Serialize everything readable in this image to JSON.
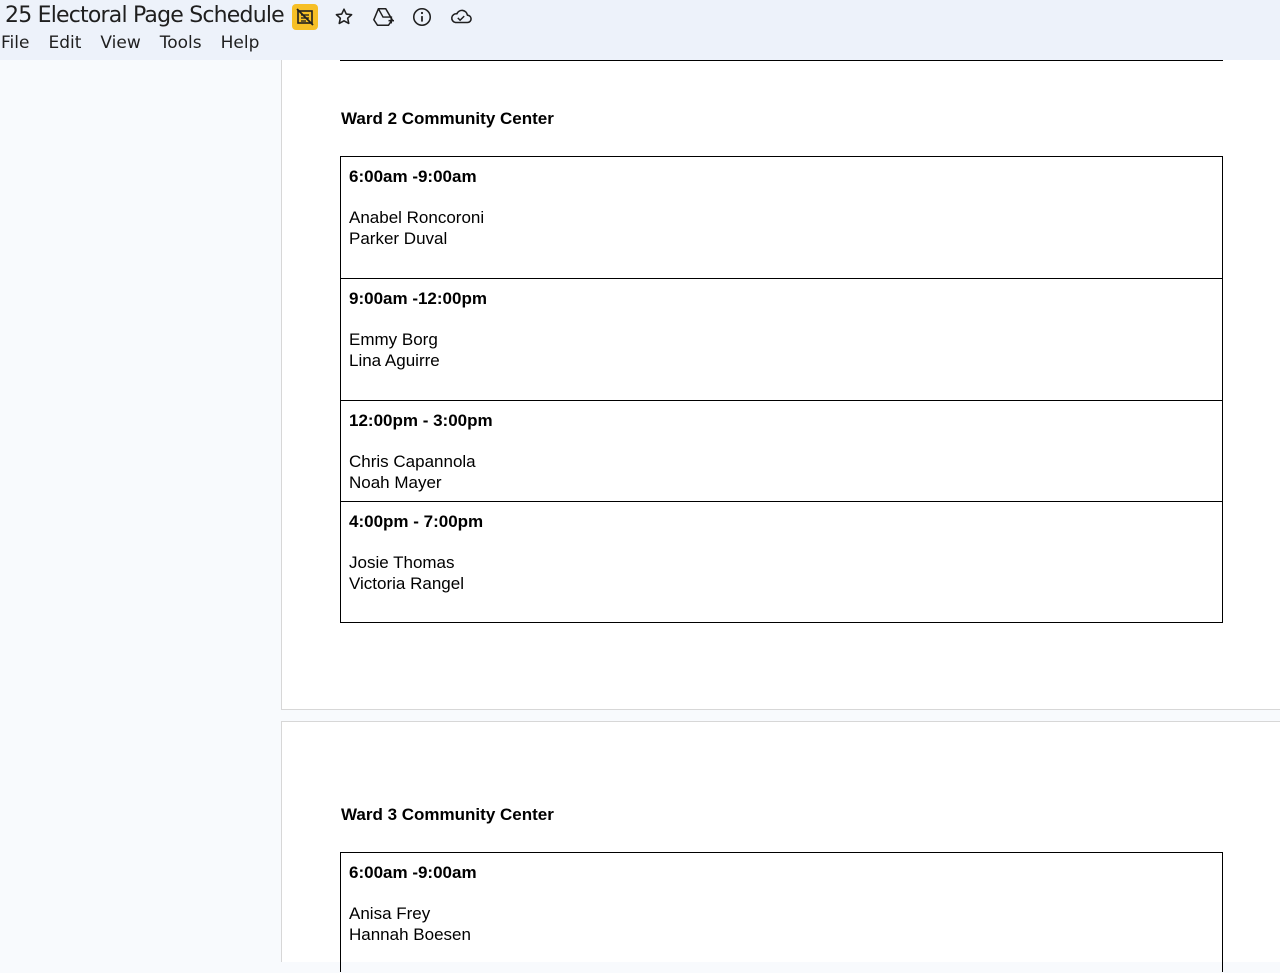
{
  "doc": {
    "title": "25 Electoral Page Schedule"
  },
  "title_icons": [
    {
      "icon": "offline-status-icon"
    },
    {
      "icon": "star-icon"
    },
    {
      "icon": "move-to-drive-icon"
    },
    {
      "icon": "info-icon"
    },
    {
      "icon": "cloud-saved-icon"
    }
  ],
  "menu": [
    "File",
    "Edit",
    "View",
    "Tools",
    "Help"
  ],
  "sections": [
    {
      "heading": "Ward 2 Community Center",
      "shifts": [
        {
          "time": "6:00am -9:00am",
          "names": [
            "Anabel Roncoroni",
            "Parker Duval"
          ]
        },
        {
          "time": "9:00am -12:00pm",
          "names": [
            "Emmy Borg",
            "Lina Aguirre"
          ]
        },
        {
          "time": "12:00pm - 3:00pm",
          "names": [
            "Chris Capannola",
            "Noah Mayer"
          ]
        },
        {
          "time": "4:00pm - 7:00pm",
          "names": [
            "Josie Thomas",
            "Victoria Rangel"
          ]
        }
      ]
    },
    {
      "heading": "Ward 3 Community Center",
      "shifts": [
        {
          "time": "6:00am -9:00am",
          "names": [
            "Anisa Frey",
            "Hannah Boesen"
          ]
        }
      ]
    }
  ]
}
